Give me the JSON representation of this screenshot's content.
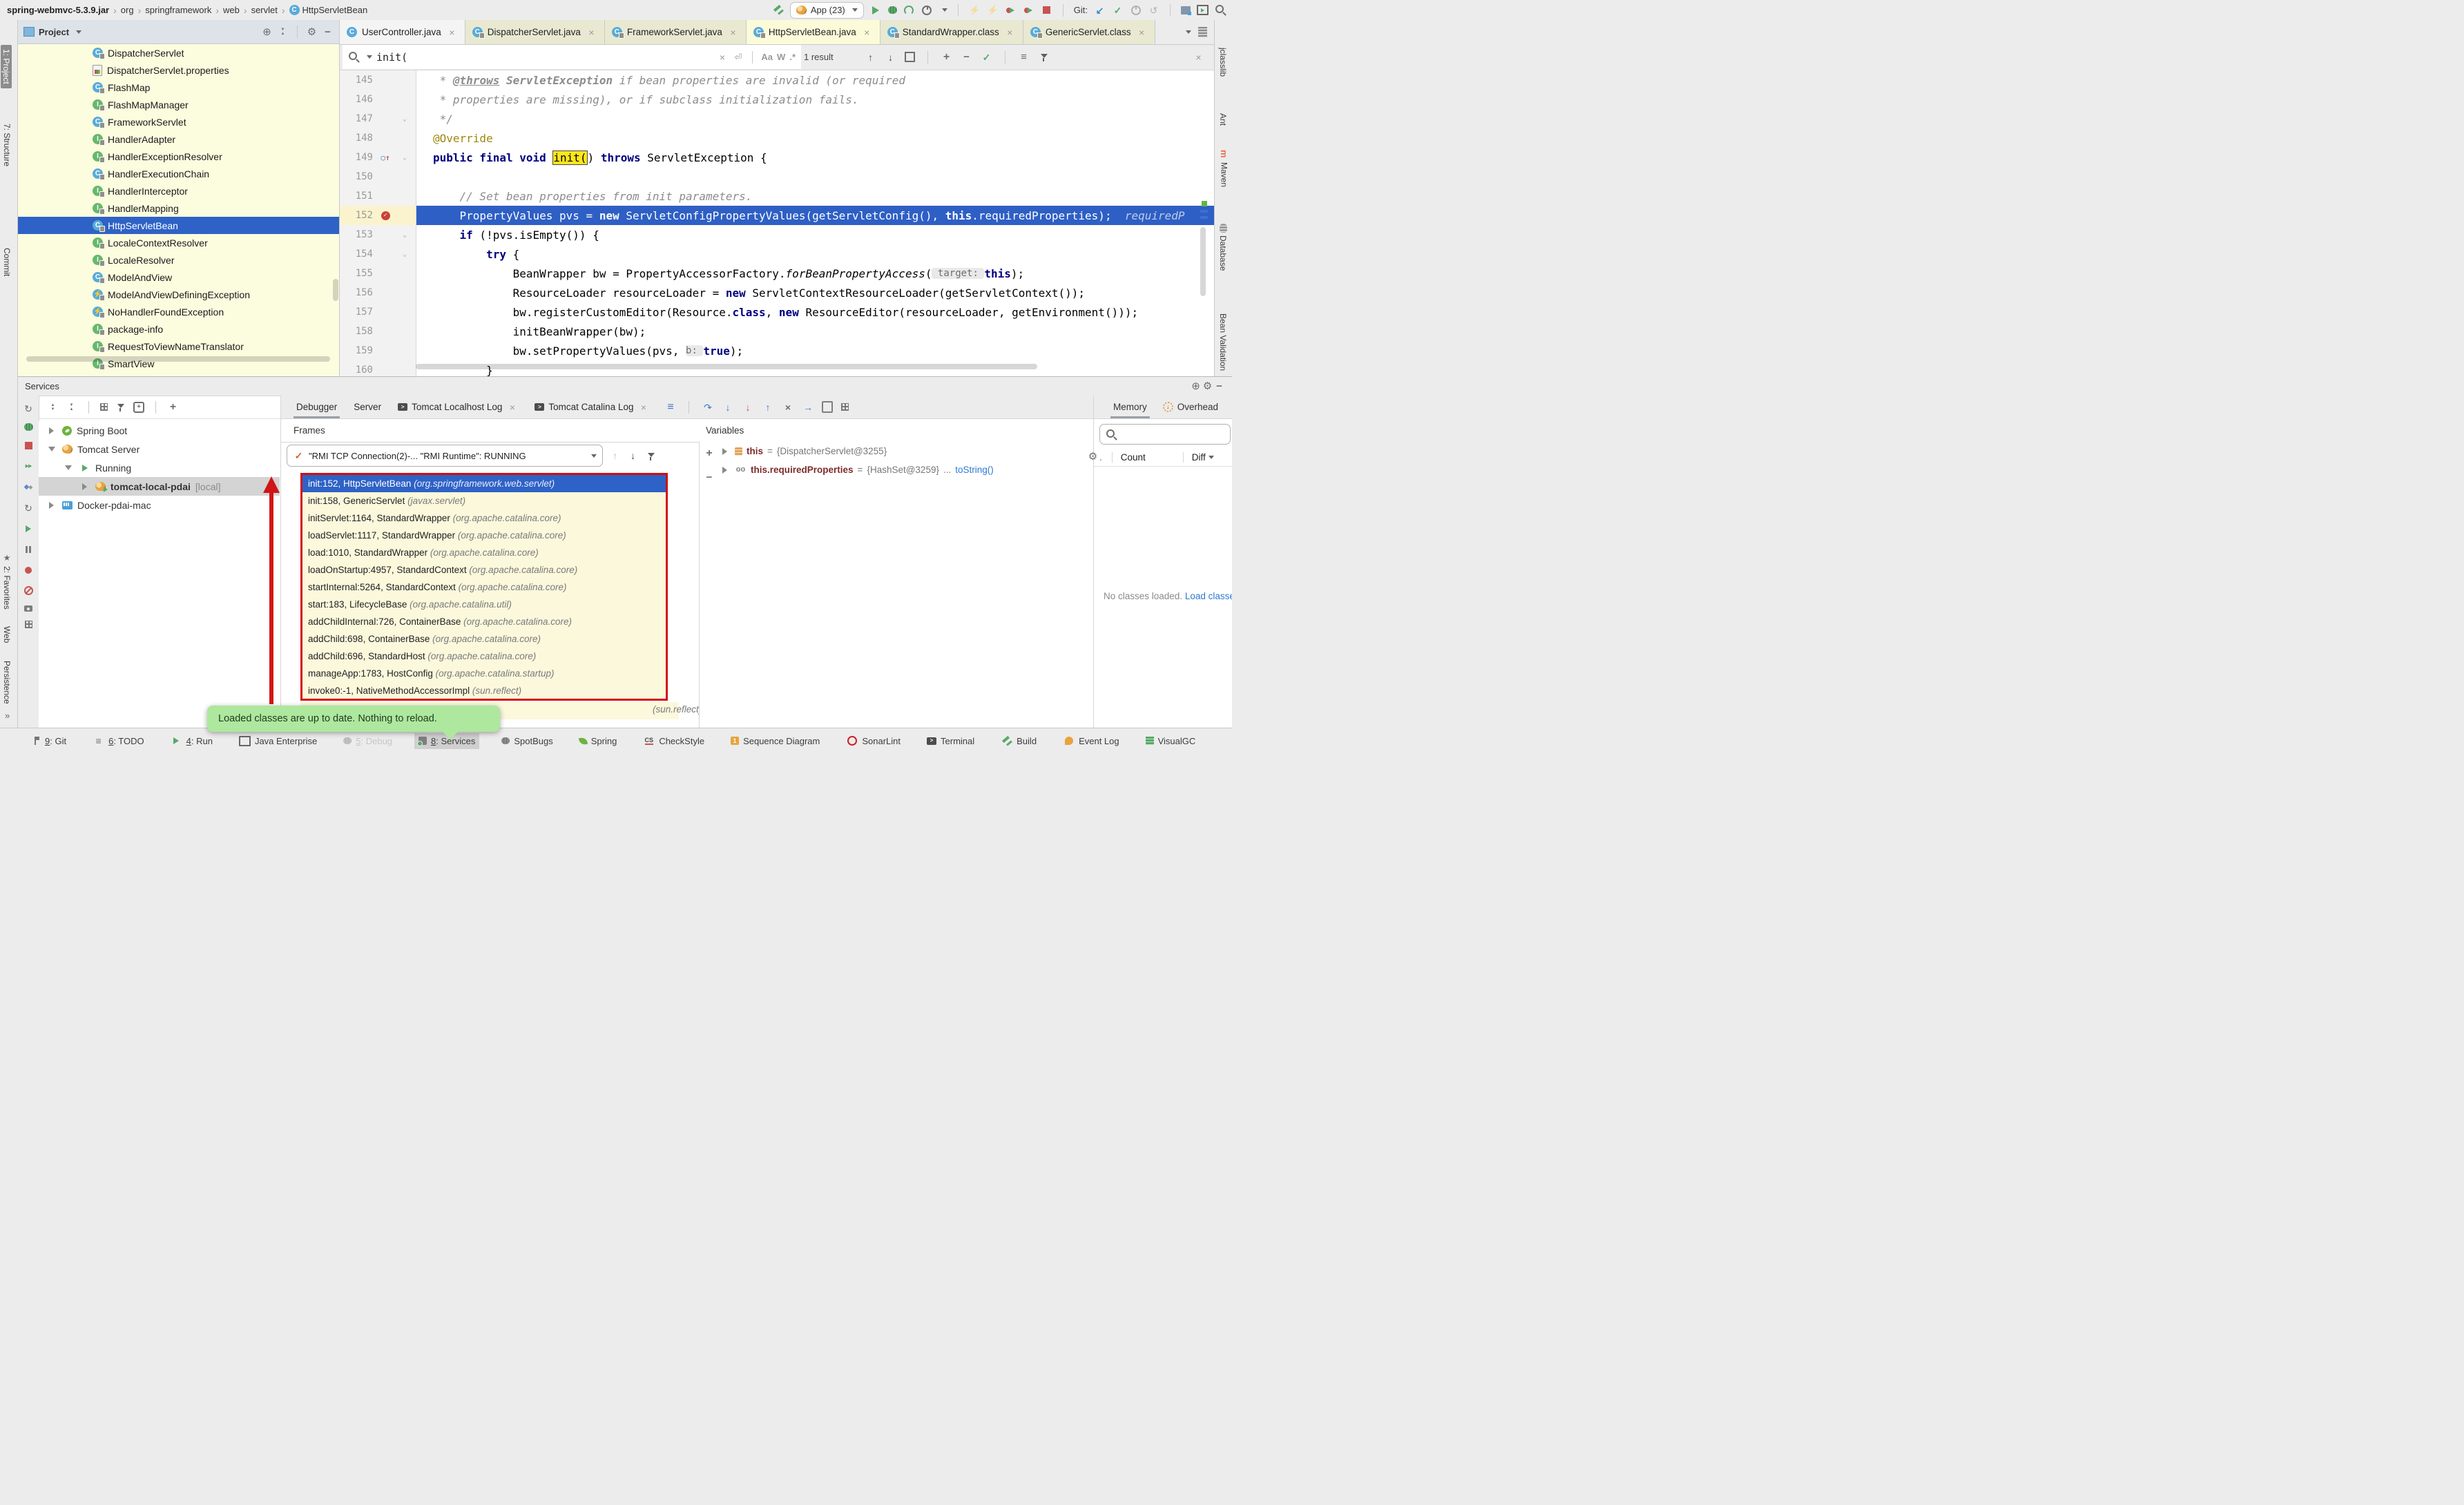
{
  "colors": {
    "accent": "#2E62C6",
    "exec_line": "#2E5FC4",
    "annotation_red": "#D40D0D",
    "tooltip_green": "#AEE79E",
    "frames_bg": "#FBF8DC",
    "selection_blue": "#2E62C6"
  },
  "titlebar": {
    "breadcrumbs": [
      {
        "label": "spring-webmvc-5.3.9.jar",
        "bold": true
      },
      {
        "label": "org"
      },
      {
        "label": "springframework"
      },
      {
        "label": "web"
      },
      {
        "label": "servlet"
      },
      {
        "label": "HttpServletBean",
        "icon": "class-icon"
      }
    ],
    "run_config": "App (23)",
    "git_label": "Git:",
    "icons_left_of_chip": [
      {
        "n": "build-icon",
        "c": "i-hammer"
      }
    ],
    "icons_after_chip": [
      {
        "n": "run-icon",
        "c": "i-play"
      },
      {
        "n": "debug-icon",
        "c": "i-bug"
      },
      {
        "n": "coverage-icon",
        "c": "i-coverage"
      },
      {
        "n": "profiler-icon",
        "c": "i-clock",
        "caret": true
      },
      {
        "sep": true
      },
      {
        "n": "reload-icon",
        "c": "i-lightning dim"
      },
      {
        "n": "reload-debug-icon",
        "c": "i-lightning dim"
      },
      {
        "n": "hotswap-run-icon",
        "c": "i-hotswap"
      },
      {
        "n": "hotswap-debug-icon",
        "c": "i-hotswap"
      },
      {
        "n": "stop-icon",
        "c": "i-stop"
      },
      {
        "sep": true
      },
      {
        "label": "Git:"
      },
      {
        "n": "update-project-icon",
        "c": "i-blue-down"
      },
      {
        "n": "commit-icon",
        "c": "i-check"
      },
      {
        "n": "history-icon",
        "c": "i-clock dim"
      },
      {
        "n": "rollback-icon",
        "c": "i-undo dim"
      },
      {
        "sep": true
      },
      {
        "n": "remote-host-icon",
        "c": "i-remote"
      },
      {
        "n": "run-anything-icon",
        "c": "i-runwin"
      },
      {
        "n": "search-everywhere-icon",
        "c": "i-search-g"
      }
    ]
  },
  "left_stripe": {
    "top": [
      {
        "label": "1: Project",
        "active": true
      },
      {
        "label": "7: Structure"
      },
      {
        "label": "Commit"
      }
    ],
    "bottom": [
      {
        "label": "2: Favorites",
        "icon": "star-icon"
      },
      {
        "label": "Web"
      },
      {
        "label": "Persistence"
      }
    ],
    "more": "»"
  },
  "right_stripe": [
    {
      "label": "jclasslib"
    },
    {
      "label": "Ant"
    },
    {
      "label": "Maven",
      "icon": "maven-icon"
    },
    {
      "label": "Database",
      "icon": "database-icon"
    },
    {
      "label": "Bean Validation"
    }
  ],
  "project": {
    "title": "Project",
    "items": [
      {
        "label": "DispatcherServlet",
        "icon": "class"
      },
      {
        "label": "DispatcherServlet.properties",
        "icon": "properties"
      },
      {
        "label": "FlashMap",
        "icon": "class"
      },
      {
        "label": "FlashMapManager",
        "icon": "interface"
      },
      {
        "label": "FrameworkServlet",
        "icon": "class"
      },
      {
        "label": "HandlerAdapter",
        "icon": "interface"
      },
      {
        "label": "HandlerExceptionResolver",
        "icon": "interface"
      },
      {
        "label": "HandlerExecutionChain",
        "icon": "class"
      },
      {
        "label": "HandlerInterceptor",
        "icon": "interface"
      },
      {
        "label": "HandlerMapping",
        "icon": "interface"
      },
      {
        "label": "HttpServletBean",
        "icon": "class",
        "selected": true
      },
      {
        "label": "LocaleContextResolver",
        "icon": "interface"
      },
      {
        "label": "LocaleResolver",
        "icon": "interface"
      },
      {
        "label": "ModelAndView",
        "icon": "class"
      },
      {
        "label": "ModelAndViewDefiningException",
        "icon": "exception"
      },
      {
        "label": "NoHandlerFoundException",
        "icon": "exception"
      },
      {
        "label": "package-info",
        "icon": "interface"
      },
      {
        "label": "RequestToViewNameTranslator",
        "icon": "interface"
      },
      {
        "label": "SmartView",
        "icon": "interface"
      }
    ]
  },
  "editor": {
    "tabs": [
      {
        "label": "UserController.java",
        "icon": "class",
        "lock": false,
        "cls": ""
      },
      {
        "label": "DispatcherServlet.java",
        "icon": "class",
        "lock": true,
        "cls": "lib"
      },
      {
        "label": "FrameworkServlet.java",
        "icon": "class",
        "lock": true,
        "cls": "lib"
      },
      {
        "label": "HttpServletBean.java",
        "icon": "class",
        "lock": true,
        "cls": "lib active"
      },
      {
        "label": "StandardWrapper.class",
        "icon": "class",
        "lock": true,
        "cls": "lib"
      },
      {
        "label": "GenericServlet.class",
        "icon": "class",
        "lock": true,
        "cls": "lib"
      }
    ],
    "search": {
      "query": "init(",
      "match_case": "Aa",
      "words": "W",
      "regex": ".*",
      "results": "1 result"
    },
    "lines": [
      {
        "n": 145,
        "s": [
          [
            "d",
            " * "
          ],
          [
            "dt",
            "@throws"
          ],
          [
            "d",
            " "
          ],
          [
            "db",
            "ServletException"
          ],
          [
            "d",
            " if bean properties are invalid (or required"
          ]
        ]
      },
      {
        "n": 146,
        "s": [
          [
            "d",
            " * properties are missing), or if subclass initialization fails."
          ]
        ]
      },
      {
        "n": 147,
        "fold": "v",
        "s": [
          [
            "d",
            " */"
          ]
        ]
      },
      {
        "n": 148,
        "s": [
          [
            "a",
            "@Override"
          ]
        ]
      },
      {
        "n": 149,
        "icon": "override",
        "fold": "v",
        "s": [
          [
            "k",
            "public final void "
          ],
          [
            "m",
            "init("
          ],
          [
            "p",
            ") "
          ],
          [
            "k",
            "throws"
          ],
          [
            "p",
            " ServletException {"
          ]
        ]
      },
      {
        "n": 150,
        "s": []
      },
      {
        "n": 151,
        "s": [
          [
            "c",
            "    // Set bean properties from init parameters."
          ]
        ]
      },
      {
        "n": 152,
        "icon": "breakpoint",
        "exec": true,
        "s": [
          [
            "p",
            "    PropertyValues pvs = "
          ],
          [
            "k",
            "new"
          ],
          [
            "p",
            " ServletConfigPropertyValues(getServletConfig(), "
          ],
          [
            "k",
            "this"
          ],
          [
            "p",
            ".requiredProperties);"
          ],
          [
            "hx",
            "  requiredP"
          ]
        ]
      },
      {
        "n": 153,
        "fold": "v",
        "s": [
          [
            "p",
            "    "
          ],
          [
            "k",
            "if"
          ],
          [
            "p",
            " (!pvs.isEmpty()) {"
          ]
        ]
      },
      {
        "n": 154,
        "fold": "v",
        "s": [
          [
            "p",
            "        "
          ],
          [
            "k",
            "try"
          ],
          [
            "p",
            " {"
          ]
        ]
      },
      {
        "n": 155,
        "s": [
          [
            "p",
            "            BeanWrapper bw = PropertyAccessorFactory."
          ],
          [
            "it",
            "forBeanPropertyAccess"
          ],
          [
            "p",
            "("
          ],
          [
            "h",
            " target: "
          ],
          [
            "k",
            "this"
          ],
          [
            "p",
            ");"
          ]
        ]
      },
      {
        "n": 156,
        "s": [
          [
            "p",
            "            ResourceLoader resourceLoader = "
          ],
          [
            "k",
            "new"
          ],
          [
            "p",
            " ServletContextResourceLoader(getServletContext());"
          ]
        ]
      },
      {
        "n": 157,
        "s": [
          [
            "p",
            "            bw.registerCustomEditor(Resource."
          ],
          [
            "k",
            "class"
          ],
          [
            "p",
            ", "
          ],
          [
            "k",
            "new"
          ],
          [
            "p",
            " ResourceEditor(resourceLoader, getEnvironment()));"
          ]
        ]
      },
      {
        "n": 158,
        "s": [
          [
            "p",
            "            initBeanWrapper(bw);"
          ]
        ]
      },
      {
        "n": 159,
        "s": [
          [
            "p",
            "            bw.setPropertyValues(pvs, "
          ],
          [
            "h",
            "b: "
          ],
          [
            "k",
            "true"
          ],
          [
            "p",
            ");"
          ]
        ]
      },
      {
        "n": 160,
        "s": [
          [
            "p",
            "        }"
          ]
        ]
      }
    ]
  },
  "services": {
    "title": "Services",
    "tree": [
      {
        "label": "Spring Boot",
        "icon": "spring-boot-icon",
        "expander": "r",
        "indent": 10
      },
      {
        "label": "Tomcat Server",
        "icon": "tomcat-icon",
        "expander": "d",
        "indent": 10
      },
      {
        "label": "Running",
        "icon": "running-icon",
        "expander": "d",
        "indent": 34
      },
      {
        "label": "tomcat-local-pdai",
        "suffix": " [local]",
        "icon": "tomcat-run-icon",
        "expander": "r",
        "indent": 58,
        "bold": true,
        "selected": true
      },
      {
        "label": "Docker-pdai-mac",
        "icon": "docker-icon",
        "expander": "r",
        "indent": 10
      }
    ],
    "debug_tabs": [
      {
        "label": "Debugger",
        "active": true
      },
      {
        "label": "Server"
      },
      {
        "label": "Tomcat Localhost Log",
        "icon": "terminal-icon",
        "closable": true
      },
      {
        "label": "Tomcat Catalina Log",
        "icon": "terminal-icon",
        "closable": true
      }
    ],
    "frames": {
      "title": "Frames",
      "thread": "\"RMI TCP Connection(2)-... \"RMI Runtime\": RUNNING",
      "rows": [
        {
          "m": "init:152, HttpServletBean ",
          "p": "(org.springframework.web.servlet)",
          "sel": true
        },
        {
          "m": "init:158, GenericServlet ",
          "p": "(javax.servlet)"
        },
        {
          "m": "initServlet:1164, StandardWrapper ",
          "p": "(org.apache.catalina.core)"
        },
        {
          "m": "loadServlet:1117, StandardWrapper ",
          "p": "(org.apache.catalina.core)"
        },
        {
          "m": "load:1010, StandardWrapper ",
          "p": "(org.apache.catalina.core)"
        },
        {
          "m": "loadOnStartup:4957, StandardContext ",
          "p": "(org.apache.catalina.core)"
        },
        {
          "m": "startInternal:5264, StandardContext ",
          "p": "(org.apache.catalina.core)"
        },
        {
          "m": "start:183, LifecycleBase ",
          "p": "(org.apache.catalina.util)"
        },
        {
          "m": "addChildInternal:726, ContainerBase ",
          "p": "(org.apache.catalina.core)"
        },
        {
          "m": "addChild:698, ContainerBase ",
          "p": "(org.apache.catalina.core)"
        },
        {
          "m": "addChild:696, StandardHost ",
          "p": "(org.apache.catalina.core)"
        },
        {
          "m": "manageApp:1783, HostConfig ",
          "p": "(org.apache.catalina.startup)"
        },
        {
          "m": "invoke0:-1, NativeMethodAccessorImpl ",
          "p": "(sun.reflect)"
        }
      ],
      "partial_row_package": "(sun.reflect)"
    },
    "variables": {
      "title": "Variables",
      "rows": [
        {
          "icon": "value-icon",
          "name": "this",
          "eq": " = ",
          "value": "{DispatcherServlet@3255}"
        },
        {
          "icon": "watch-icon",
          "name": "this.requiredProperties",
          "eq": " = ",
          "value": "{HashSet@3259}",
          "ellipsis": " ... ",
          "link": "toString()"
        }
      ]
    },
    "memory": {
      "tabs": [
        {
          "label": "Memory",
          "active": true
        },
        {
          "label": "Overhead",
          "icon": "overhead-icon"
        }
      ],
      "first_col": ".",
      "columns": [
        "Count",
        "Diff"
      ],
      "note": "No classes loaded.",
      "link": "Load classes"
    }
  },
  "tooltip": "Loaded classes are up to date. Nothing to reload.",
  "statusbar": {
    "items": [
      {
        "icon": "vcs",
        "prefix": "9",
        "label": "Git"
      },
      {
        "icon": "todo",
        "prefix": "6",
        "label": "TODO"
      },
      {
        "icon": "play-sm",
        "prefix": "4",
        "label": "Run"
      },
      {
        "icon": "jee",
        "label": "Java Enterprise"
      },
      {
        "icon": "bug-gray",
        "prefix": "5",
        "label": "Debug",
        "dim": true
      },
      {
        "icon": "services-sm",
        "prefix": "8",
        "label": "Services",
        "active": true
      },
      {
        "icon": "bug-gray",
        "label": "SpotBugs"
      },
      {
        "icon": "leaf",
        "label": "Spring"
      },
      {
        "icon": "checkstyle",
        "label": "CheckStyle"
      },
      {
        "icon": "seq",
        "label": "Sequence Diagram"
      },
      {
        "icon": "sonarlint",
        "label": "SonarLint"
      },
      {
        "icon": "terminal",
        "label": "Terminal"
      },
      {
        "icon": "hammer",
        "label": "Build"
      },
      {
        "icon": "eventlog",
        "label": "Event Log"
      },
      {
        "icon": "visualgc",
        "label": "VisualGC"
      }
    ]
  }
}
